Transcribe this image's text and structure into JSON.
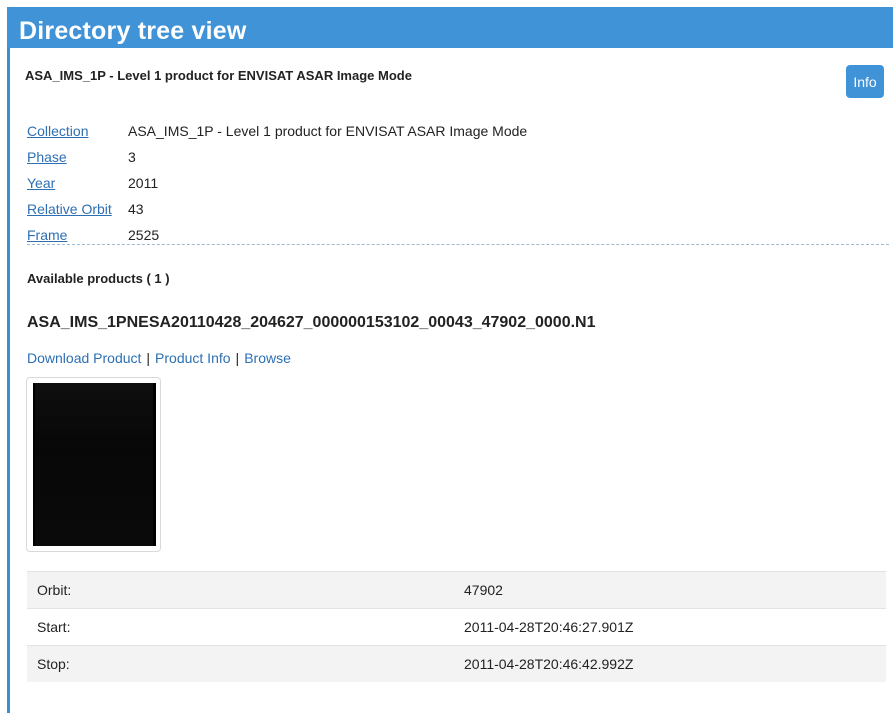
{
  "header": {
    "title": "Directory tree view"
  },
  "subheader": {
    "title": "ASA_IMS_1P - Level 1 product for ENVISAT ASAR Image Mode",
    "info_button": "Info"
  },
  "meta": [
    {
      "key": "Collection",
      "value": "ASA_IMS_1P - Level 1 product for ENVISAT ASAR Image Mode"
    },
    {
      "key": "Phase",
      "value": "3"
    },
    {
      "key": "Year",
      "value": "2011"
    },
    {
      "key": "Relative Orbit",
      "value": "43"
    },
    {
      "key": "Frame",
      "value": "2525"
    }
  ],
  "available": "Available products ( 1 )",
  "product": {
    "name": "ASA_IMS_1PNESA20110428_204627_000000153102_00043_47902_0000.N1",
    "links": {
      "download": "Download Product",
      "info": "Product Info",
      "browse": "Browse",
      "separator": "|"
    }
  },
  "details": [
    {
      "key": "Orbit:",
      "value": "47902"
    },
    {
      "key": "Start:",
      "value": "2011-04-28T20:46:27.901Z"
    },
    {
      "key": "Stop:",
      "value": "2011-04-28T20:46:42.992Z"
    }
  ],
  "colors": {
    "accent": "#3f93d6",
    "link": "#2d6fb3"
  }
}
